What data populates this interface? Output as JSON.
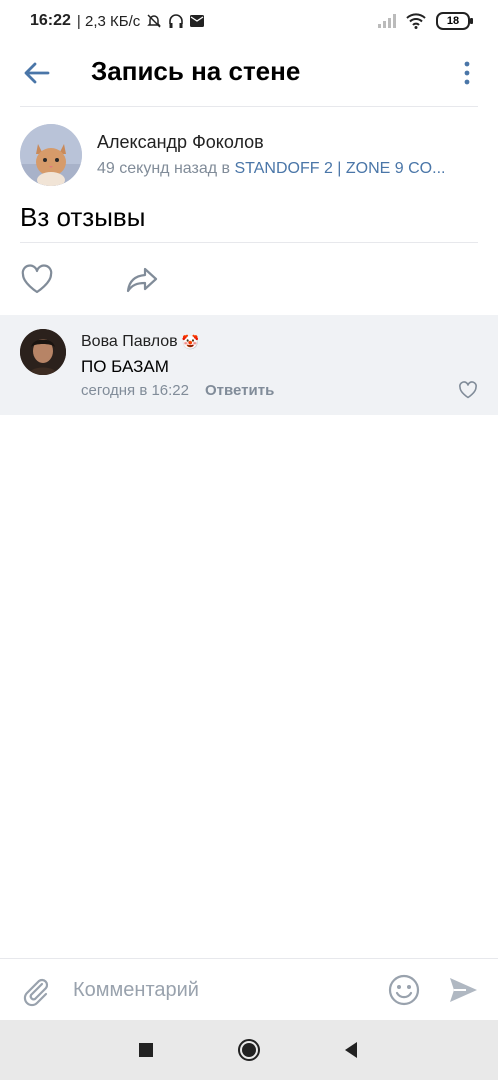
{
  "statusbar": {
    "time": "16:22",
    "speed": "| 2,3 КБ/с",
    "battery": "18"
  },
  "appbar": {
    "title": "Запись на стене"
  },
  "post": {
    "author": "Александр Фоколов",
    "time": "49 секунд назад в",
    "group": "STANDOFF 2 | ZONE 9 CO...",
    "text": "Вз отзывы"
  },
  "comment": {
    "author": "Вова Павлов",
    "emoji": "🤡",
    "text": "ПО БАЗАМ",
    "time": "сегодня в 16:22",
    "reply_label": "Ответить"
  },
  "composer": {
    "placeholder": "Комментарий"
  },
  "colors": {
    "accent": "#4a76a8",
    "muted": "#818c99",
    "comment_bg": "#f0f2f5"
  },
  "icons": [
    "back-arrow-icon",
    "more-vertical-icon",
    "like-icon",
    "share-icon",
    "attach-icon",
    "emoji-icon",
    "send-icon",
    "recents-icon",
    "home-icon",
    "back-icon"
  ]
}
